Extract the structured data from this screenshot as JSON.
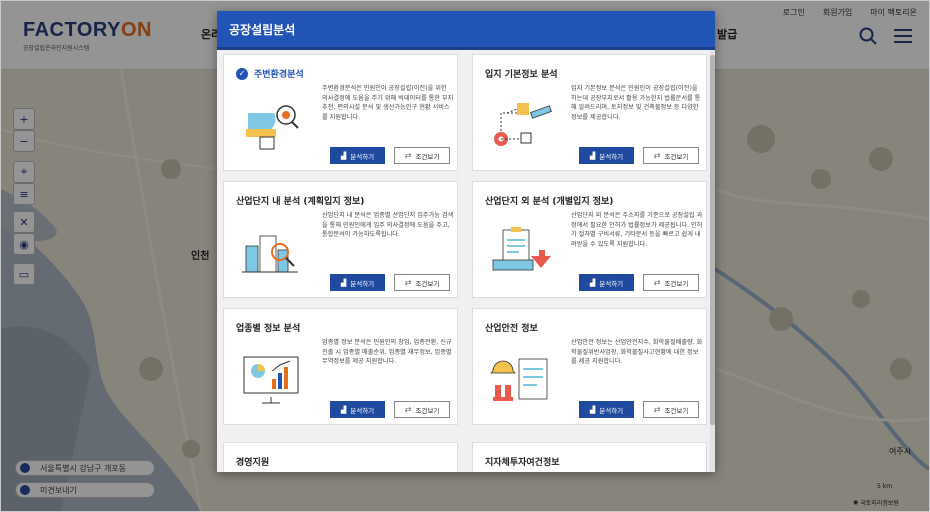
{
  "header": {
    "logo_main": "FACTORY",
    "logo_on": "ON",
    "logo_sub": "공장설립온라인지원시스템",
    "util_links": [
      "로그인",
      "회원가입",
      "마이 팩토리온"
    ],
    "gnb_left": "온라",
    "gnb_right": "발급"
  },
  "map": {
    "labels": [
      "인천",
      "서울특별시 강남구 개포동",
      "미견보내기",
      "5 km",
      "국토지리정보원",
      "여주시"
    ],
    "location_text": "서울특별시 강남구 개포동",
    "share_text": "미견보내기",
    "scale_text": "5 km",
    "credit_text": "국토지리정보원"
  },
  "modal": {
    "title": "공장설립분석",
    "analyze_label": "분석하기",
    "view_label": "조건보기",
    "cards": [
      {
        "title": "주변환경분석",
        "active": true,
        "desc": "주변환경분석은 민원인이 공장설립(이전)을 위한 의사결정에 도움을 주기 위해 빅데이터를 통한 부지추천, 편의시설 분석 및 생산가능인구 현황 서비스를 지원합니다."
      },
      {
        "title": "입지 기본정보 분석",
        "active": false,
        "desc": "입지 기본정보 분석은 민원인이 공장설립(이전)을 하는데 공장부지로서 활용 가능한지 법률문서를 통해 알려드리며, 토지정보 및 건축물정보 등 다양한 정보를 제공합니다."
      },
      {
        "title": "산업단지 내 분석 (계획입지 정보)",
        "active": false,
        "desc": "산업단지 내 분석은 업종별 산업단지 입주가능 검색을 통해 민원인에게 입주 의사결정에 도움을 주고, 통합분석이 가능하도록합니다."
      },
      {
        "title": "산업단지 외 분석 (개별입지 정보)",
        "active": false,
        "desc": "산업단지 외 분석은 주소지를 기준으로 공장설립 과정에서 필요한 인허가 법률정보가 제공됩니다. 인허가 절차별 구비서류, 기타문서 등을 빠르고 쉽게 내려받을 수 있도록 지원합니다."
      },
      {
        "title": "업종별 정보 분석",
        "active": false,
        "desc": "업종별 정보 분석은 민원인의 창업, 업종전환, 신규 진출 시 업종별 매출순위, 업종별 재무정보, 업종별 무역정보를 제공 지원합니다."
      },
      {
        "title": "산업안전 정보",
        "active": false,
        "desc": "산업안전 정보는 산업안전지수, 화학물질배출량, 화학물질위반사업장, 화학물질사고현황에 대한 정보를 제공 지원합니다."
      },
      {
        "title": "경영지원",
        "active": false,
        "desc": ""
      },
      {
        "title": "지자체투자여건정보",
        "active": false,
        "desc": ""
      }
    ]
  },
  "colors": {
    "primary": "#2254b7",
    "button": "#1f4aa0",
    "logo_blue": "#2a3f7e",
    "logo_orange": "#e46f1f"
  }
}
